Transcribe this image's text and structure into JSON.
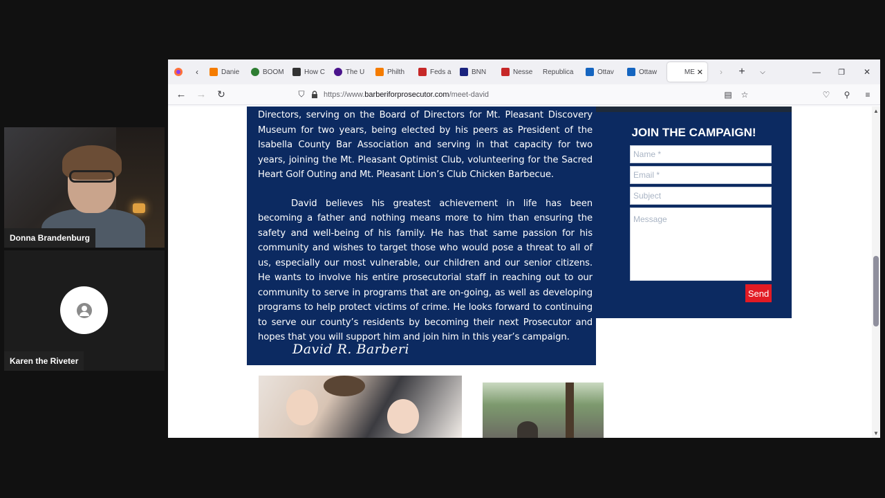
{
  "participants": [
    {
      "name": "Donna Brandenburg"
    },
    {
      "name": "Karen the Riveter"
    }
  ],
  "browser": {
    "tabs": [
      {
        "label": "Danie",
        "color": "#f57c00"
      },
      {
        "label": "BOOM",
        "color": "#2e7d32"
      },
      {
        "label": "How C",
        "color": "#333333"
      },
      {
        "label": "The U",
        "color": "#4a148c"
      },
      {
        "label": "Philth",
        "color": "#f57c00"
      },
      {
        "label": "Feds a",
        "color": "#c62828"
      },
      {
        "label": "BNN",
        "color": "#1a237e"
      },
      {
        "label": "Nesse",
        "color": "#c62828"
      },
      {
        "label": "Republica",
        "color": "#000000"
      },
      {
        "label": "Ottav",
        "color": "#1565c0"
      },
      {
        "label": "Ottaw",
        "color": "#1565c0"
      },
      {
        "label": "ME",
        "color": "#ffffff"
      }
    ],
    "url_prefix": "https://www.",
    "url_domain": "barberiforprosecutor.com",
    "url_path": "/meet-david"
  },
  "bio": {
    "paragraph1": "Directors, serving on the Board of Directors for Mt. Pleasant Discovery Museum for two years, being elected by his peers as President of the Isabella County Bar Association and serving in that capacity for two years, joining the Mt. Pleasant Optimist Club, volunteering for the Sacred Heart Golf Outing and Mt. Pleasant Lion’s Club Chicken Barbecue.",
    "paragraph2": "David believes his greatest achievement in life has been becoming a father and nothing means more to him than ensuring the safety and well-being of his family.  He has that same passion for his community and wishes to target those who would pose a threat to all of us, especially our most vulnerable, our children and our senior citizens.  He wants to involve his entire prosecutorial staff in reaching out to our community to serve in programs that are on-going, as well as developing programs to help protect victims of crime. He looks forward to continuing to serve our county’s residents by becoming their next Prosecutor and hopes that you will support him and join him in this year’s campaign.",
    "signature": "David R. Barberi"
  },
  "form": {
    "title": "JOIN THE CAMPAIGN!",
    "name_placeholder": "Name *",
    "email_placeholder": "Email *",
    "subject_placeholder": "Subject",
    "message_placeholder": "Message",
    "send_label": "Send"
  }
}
